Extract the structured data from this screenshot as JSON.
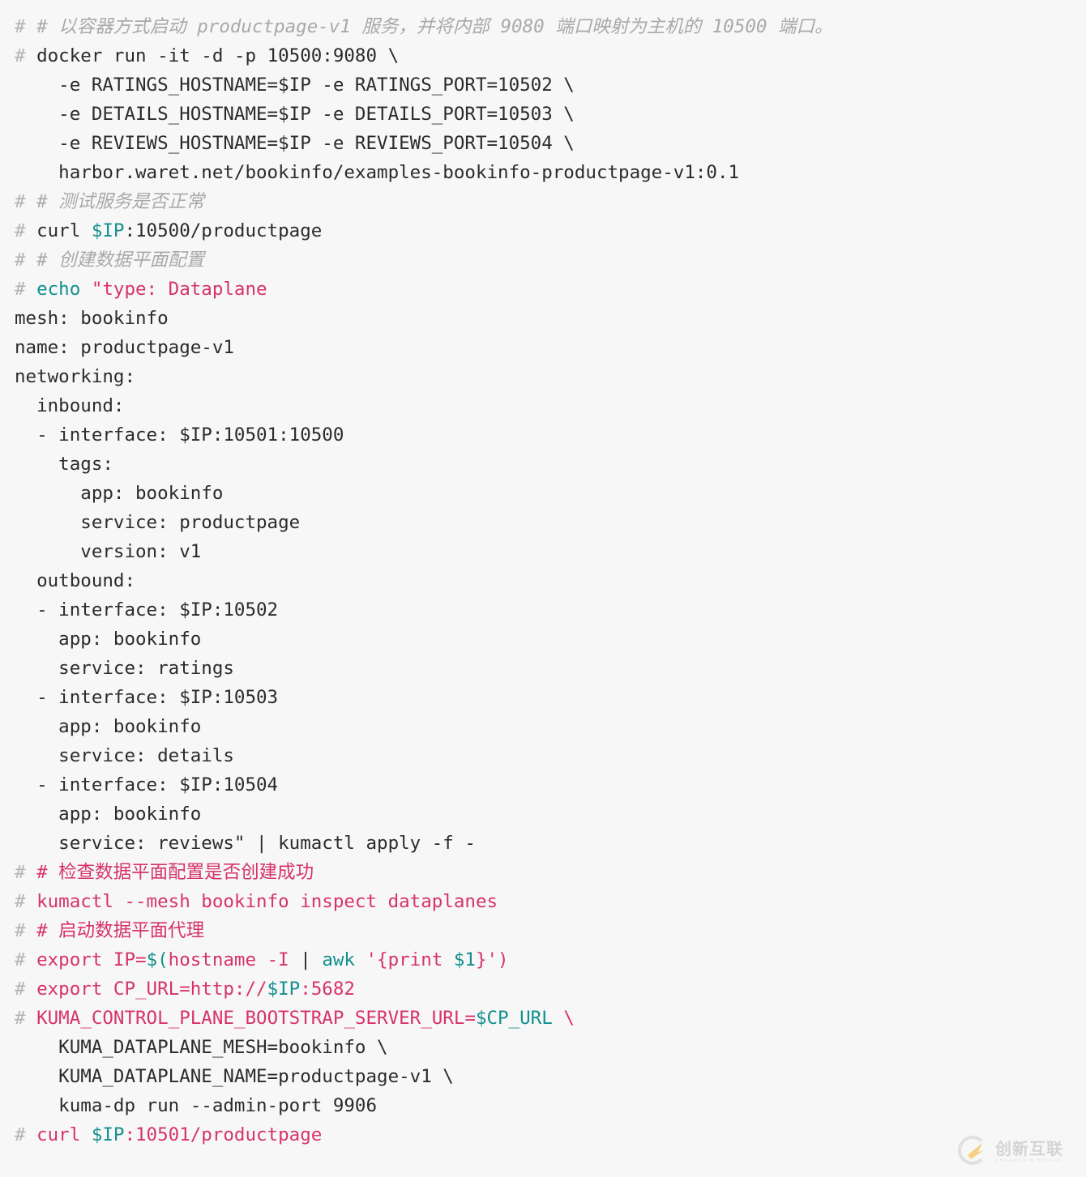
{
  "page": {
    "kind": "code-snippet",
    "language": "shell",
    "background_color": "#f7f7f7"
  },
  "colors": {
    "background": "#f7f7f7",
    "plain_text": "#2b2b2b",
    "prompt_hash": "#b3b3b3",
    "comment_grey": "#a9a9a9",
    "comment_red": "#d6336c",
    "keyword_red": "#d6336c",
    "variable_teal": "#148f8f"
  },
  "code": {
    "lines": [
      {
        "id": "l1",
        "text": "# # 以容器方式启动 productpage-v1 服务，并将内部 9080 端口映射为主机的 10500 端口。"
      },
      {
        "id": "l2",
        "text": "# docker run -it -d -p 10500:9080 \\"
      },
      {
        "id": "l3",
        "text": "    -e RATINGS_HOSTNAME=$IP -e RATINGS_PORT=10502 \\"
      },
      {
        "id": "l4",
        "text": "    -e DETAILS_HOSTNAME=$IP -e DETAILS_PORT=10503 \\"
      },
      {
        "id": "l5",
        "text": "    -e REVIEWS_HOSTNAME=$IP -e REVIEWS_PORT=10504 \\"
      },
      {
        "id": "l6",
        "text": "    harbor.waret.net/bookinfo/examples-bookinfo-productpage-v1:0.1"
      },
      {
        "id": "l7",
        "text": "# # 测试服务是否正常"
      },
      {
        "id": "l8",
        "text": "# curl $IP:10500/productpage"
      },
      {
        "id": "l9",
        "text": "# # 创建数据平面配置"
      },
      {
        "id": "l10",
        "text": "# echo \"type: Dataplane"
      },
      {
        "id": "l11",
        "text": "mesh: bookinfo"
      },
      {
        "id": "l12",
        "text": "name: productpage-v1"
      },
      {
        "id": "l13",
        "text": "networking:"
      },
      {
        "id": "l14",
        "text": "  inbound:"
      },
      {
        "id": "l15",
        "text": "  - interface: $IP:10501:10500"
      },
      {
        "id": "l16",
        "text": "    tags:"
      },
      {
        "id": "l17",
        "text": "      app: bookinfo"
      },
      {
        "id": "l18",
        "text": "      service: productpage"
      },
      {
        "id": "l19",
        "text": "      version: v1"
      },
      {
        "id": "l20",
        "text": "  outbound:"
      },
      {
        "id": "l21",
        "text": "  - interface: $IP:10502"
      },
      {
        "id": "l22",
        "text": "    app: bookinfo"
      },
      {
        "id": "l23",
        "text": "    service: ratings"
      },
      {
        "id": "l24",
        "text": "  - interface: $IP:10503"
      },
      {
        "id": "l25",
        "text": "    app: bookinfo"
      },
      {
        "id": "l26",
        "text": "    service: details"
      },
      {
        "id": "l27",
        "text": "  - interface: $IP:10504"
      },
      {
        "id": "l28",
        "text": "    app: bookinfo"
      },
      {
        "id": "l29",
        "text": "    service: reviews\" | kumactl apply -f -"
      },
      {
        "id": "l30",
        "text": "# # 检查数据平面配置是否创建成功"
      },
      {
        "id": "l31",
        "text": "# kumactl --mesh bookinfo inspect dataplanes"
      },
      {
        "id": "l32",
        "text": "# # 启动数据平面代理"
      },
      {
        "id": "l33",
        "text": "# export IP=$(hostname -I | awk '{print $1}')"
      },
      {
        "id": "l34",
        "text": "# export CP_URL=http://$IP:5682"
      },
      {
        "id": "l35",
        "text": "# KUMA_CONTROL_PLANE_BOOTSTRAP_SERVER_URL=$CP_URL \\"
      },
      {
        "id": "l36",
        "text": "    KUMA_DATAPLANE_MESH=bookinfo \\"
      },
      {
        "id": "l37",
        "text": "    KUMA_DATAPLANE_NAME=productpage-v1 \\"
      },
      {
        "id": "l38",
        "text": "    kuma-dp run --admin-port 9906"
      },
      {
        "id": "l39",
        "text": "# curl $IP:10501/productpage"
      }
    ],
    "tokens": {
      "l1": [
        {
          "t": "# ",
          "c": "prompt"
        },
        {
          "t": "# 以容器方式启动 productpage-v1 服务，并将内部 9080 端口映射为主机的 10500 端口。",
          "c": "comment"
        }
      ],
      "l2": [
        {
          "t": "# ",
          "c": "prompt"
        },
        {
          "t": "docker run -it -d -p 10500:9080 \\",
          "c": "plain"
        }
      ],
      "l3": [
        {
          "t": "    -e RATINGS_HOSTNAME=$IP -e RATINGS_PORT=10502 \\",
          "c": "plain"
        }
      ],
      "l4": [
        {
          "t": "    -e DETAILS_HOSTNAME=$IP -e DETAILS_PORT=10503 \\",
          "c": "plain"
        }
      ],
      "l5": [
        {
          "t": "    -e REVIEWS_HOSTNAME=$IP -e REVIEWS_PORT=10504 \\",
          "c": "plain"
        }
      ],
      "l6": [
        {
          "t": "    harbor.waret.net/bookinfo/examples-bookinfo-productpage-v1:0.1",
          "c": "plain"
        }
      ],
      "l7": [
        {
          "t": "# ",
          "c": "prompt"
        },
        {
          "t": "# 测试服务是否正常",
          "c": "comment"
        }
      ],
      "l8": [
        {
          "t": "# ",
          "c": "prompt"
        },
        {
          "t": "curl ",
          "c": "plain"
        },
        {
          "t": "$IP",
          "c": "teal"
        },
        {
          "t": ":10500/productpage",
          "c": "plain"
        }
      ],
      "l9": [
        {
          "t": "# ",
          "c": "prompt"
        },
        {
          "t": "# 创建数据平面配置",
          "c": "comment"
        }
      ],
      "l10": [
        {
          "t": "# ",
          "c": "prompt"
        },
        {
          "t": "echo ",
          "c": "teal"
        },
        {
          "t": "\"type: Dataplane",
          "c": "red"
        }
      ],
      "l11": [
        {
          "t": "mesh: bookinfo",
          "c": "plain"
        }
      ],
      "l12": [
        {
          "t": "name: productpage-v1",
          "c": "plain"
        }
      ],
      "l13": [
        {
          "t": "networking:",
          "c": "plain"
        }
      ],
      "l14": [
        {
          "t": "  inbound:",
          "c": "plain"
        }
      ],
      "l15": [
        {
          "t": "  - interface: $IP:10501:10500",
          "c": "plain"
        }
      ],
      "l16": [
        {
          "t": "    tags:",
          "c": "plain"
        }
      ],
      "l17": [
        {
          "t": "      app: bookinfo",
          "c": "plain"
        }
      ],
      "l18": [
        {
          "t": "      service: productpage",
          "c": "plain"
        }
      ],
      "l19": [
        {
          "t": "      version: v1",
          "c": "plain"
        }
      ],
      "l20": [
        {
          "t": "  outbound:",
          "c": "plain"
        }
      ],
      "l21": [
        {
          "t": "  - interface: $IP:10502",
          "c": "plain"
        }
      ],
      "l22": [
        {
          "t": "    app: bookinfo",
          "c": "plain"
        }
      ],
      "l23": [
        {
          "t": "    service: ratings",
          "c": "plain"
        }
      ],
      "l24": [
        {
          "t": "  - interface: $IP:10503",
          "c": "plain"
        }
      ],
      "l25": [
        {
          "t": "    app: bookinfo",
          "c": "plain"
        }
      ],
      "l26": [
        {
          "t": "    service: details",
          "c": "plain"
        }
      ],
      "l27": [
        {
          "t": "  - interface: $IP:10504",
          "c": "plain"
        }
      ],
      "l28": [
        {
          "t": "    app: bookinfo",
          "c": "plain"
        }
      ],
      "l29": [
        {
          "t": "    service: reviews\" | kumactl apply -f -",
          "c": "plain"
        }
      ],
      "l30": [
        {
          "t": "# ",
          "c": "prompt"
        },
        {
          "t": "# 检查数据平面配置是否创建成功",
          "c": "comment-red"
        }
      ],
      "l31": [
        {
          "t": "# ",
          "c": "prompt"
        },
        {
          "t": "kumactl --mesh bookinfo inspect dataplanes",
          "c": "red"
        }
      ],
      "l32": [
        {
          "t": "# ",
          "c": "prompt"
        },
        {
          "t": "# 启动数据平面代理",
          "c": "comment-red"
        }
      ],
      "l33": [
        {
          "t": "# ",
          "c": "prompt"
        },
        {
          "t": "export IP=",
          "c": "red"
        },
        {
          "t": "$(",
          "c": "teal"
        },
        {
          "t": "hostname -I ",
          "c": "red"
        },
        {
          "t": "| ",
          "c": "plain"
        },
        {
          "t": "awk ",
          "c": "teal"
        },
        {
          "t": "'{print ",
          "c": "red"
        },
        {
          "t": "$1",
          "c": "teal"
        },
        {
          "t": "}')",
          "c": "red"
        }
      ],
      "l34": [
        {
          "t": "# ",
          "c": "prompt"
        },
        {
          "t": "export CP_URL=http://",
          "c": "red"
        },
        {
          "t": "$IP",
          "c": "teal"
        },
        {
          "t": ":5682",
          "c": "red"
        }
      ],
      "l35": [
        {
          "t": "# ",
          "c": "prompt"
        },
        {
          "t": "KUMA_CONTROL_PLANE_BOOTSTRAP_SERVER_URL=",
          "c": "red"
        },
        {
          "t": "$CP_URL",
          "c": "teal"
        },
        {
          "t": " \\",
          "c": "red"
        }
      ],
      "l36": [
        {
          "t": "    KUMA_DATAPLANE_MESH=bookinfo \\",
          "c": "plain"
        }
      ],
      "l37": [
        {
          "t": "    KUMA_DATAPLANE_NAME=productpage-v1 \\",
          "c": "plain"
        }
      ],
      "l38": [
        {
          "t": "    kuma-dp run --admin-port 9906",
          "c": "plain"
        }
      ],
      "l39": [
        {
          "t": "# ",
          "c": "prompt"
        },
        {
          "t": "curl ",
          "c": "red"
        },
        {
          "t": "$IP",
          "c": "teal"
        },
        {
          "t": ":10501/productpage",
          "c": "red"
        }
      ]
    }
  },
  "watermark": {
    "logo_cn": "创新互联",
    "logo_en": "CHUANGXIN HULIAN",
    "ring_color": "#cfcfcf",
    "swoosh_color": "#f0b429"
  }
}
